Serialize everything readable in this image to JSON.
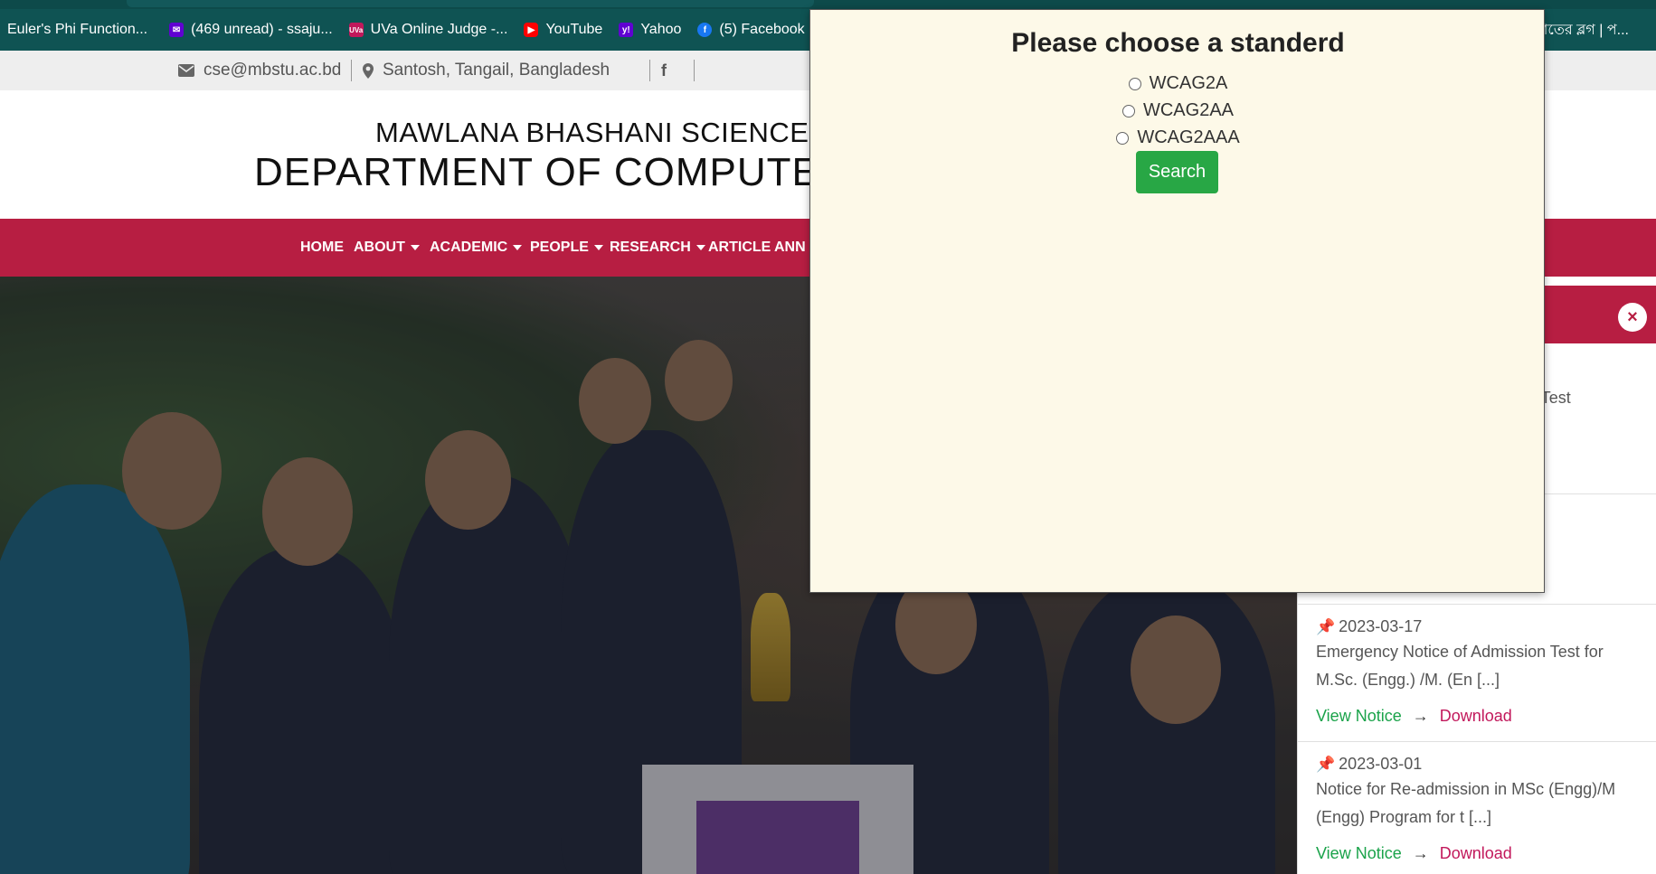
{
  "bookmarks": [
    {
      "label": "Euler's Phi Function...",
      "icon": "none"
    },
    {
      "label": "(469 unread) - ssaju...",
      "icon": "yahoo-mail-icon"
    },
    {
      "label": "UVa Online Judge -...",
      "icon": "uva-icon"
    },
    {
      "label": "YouTube",
      "icon": "youtube-icon"
    },
    {
      "label": "Yahoo",
      "icon": "yahoo-icon"
    },
    {
      "label": "(5) Facebook",
      "icon": "facebook-icon"
    }
  ],
  "bookmarks_right_text": "াতের ব্লগ | প...",
  "info_bar": {
    "email": "cse@mbstu.ac.bd",
    "location": "Santosh, Tangail, Bangladesh"
  },
  "header": {
    "university": "MAWLANA BHASHANI SCIENCE AND",
    "department": "DEPARTMENT OF COMPUTER SC"
  },
  "nav": {
    "items": [
      "HOME",
      "ABOUT",
      "ACADEMIC",
      "PEOPLE",
      "RESEARCH",
      "ARTICLE",
      "ANN"
    ]
  },
  "notice_panel": {
    "partial_text": "ion Test",
    "notices": [
      {
        "date": "2023-03-17",
        "title": "Emergency Notice of Admission Test for M.Sc. (Engg.) /M. (En [...]",
        "view_label": "View Notice",
        "arrow": "→",
        "download_label": "Download"
      },
      {
        "date": "2023-03-01",
        "title": "Notice for Re-admission in MSc (Engg)/M (Engg) Program for t [...]",
        "view_label": "View Notice",
        "arrow": "→",
        "download_label": "Download"
      }
    ]
  },
  "popup": {
    "title": "Please choose a standerd",
    "options": [
      "WCAG2A",
      "WCAG2AA",
      "WCAG2AAA"
    ],
    "search_label": "Search"
  },
  "colors": {
    "bookmarks_bg": "#0f5353",
    "nav_bg": "#b71e42",
    "popup_bg": "#fdf9e8",
    "search_btn": "#28a745",
    "view_link": "#1aa34a",
    "download_link": "#c2185b"
  }
}
